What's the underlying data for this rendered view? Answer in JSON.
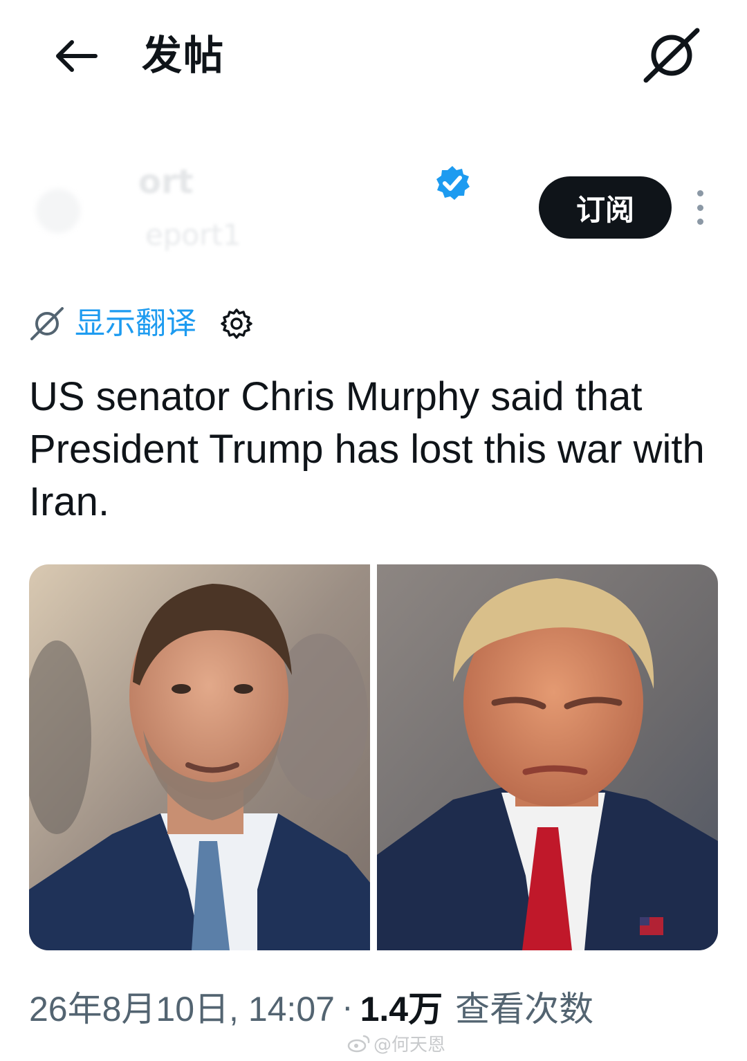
{
  "header": {
    "title": "发帖",
    "back_icon": "arrow-left-icon",
    "grok_icon": "grok-icon"
  },
  "author": {
    "name_fragment": "ort",
    "handle_fragment": "eport1",
    "verified_color": "#1d9bf0",
    "subscribe_label": "订阅"
  },
  "translate": {
    "label": "显示翻译",
    "link_color": "#1d9bf0"
  },
  "post": {
    "text": "US senator Chris Murphy said that President Trump has lost this war with Iran."
  },
  "meta": {
    "datetime": "26年8月10日, 14:07",
    "separator": "·",
    "views": "1.4万",
    "views_label": "查看次数"
  },
  "watermark": {
    "text": "@何天恩"
  }
}
